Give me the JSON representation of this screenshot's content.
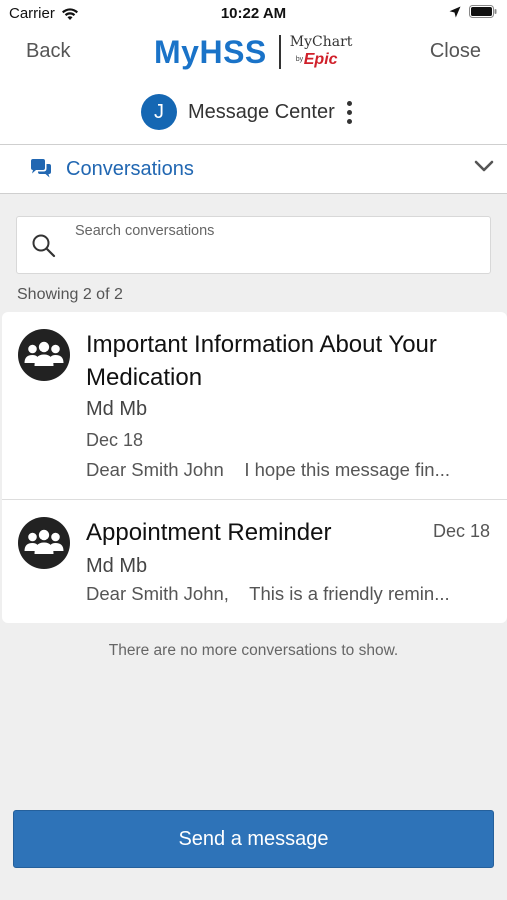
{
  "status_bar": {
    "carrier": "Carrier",
    "time": "10:22 AM"
  },
  "header": {
    "back_label": "Back",
    "close_label": "Close",
    "brand_name": "MyHSS",
    "partner_logo": {
      "line1": "MyChart",
      "by": "by",
      "epic": "Epic"
    },
    "avatar_initial": "J",
    "title": "Message Center"
  },
  "selector": {
    "label": "Conversations"
  },
  "search": {
    "placeholder": "Search conversations"
  },
  "showing_text": "Showing 2 of 2",
  "conversations": [
    {
      "title": "Important Information About Your Medication",
      "sender": "Md Mb",
      "date": "Dec 18",
      "preview": "Dear Smith John    I hope this message fin..."
    },
    {
      "title": "Appointment Reminder",
      "sender": "Md Mb",
      "date": "Dec 18",
      "preview": "Dear Smith John,    This is a friendly remin..."
    }
  ],
  "no_more_text": "There are no more conversations to show.",
  "send_button_label": "Send a message",
  "colors": {
    "brand_blue": "#1a73c8",
    "link_blue": "#2167b2",
    "button_blue": "#2e73b8",
    "epic_red": "#d0202a"
  }
}
